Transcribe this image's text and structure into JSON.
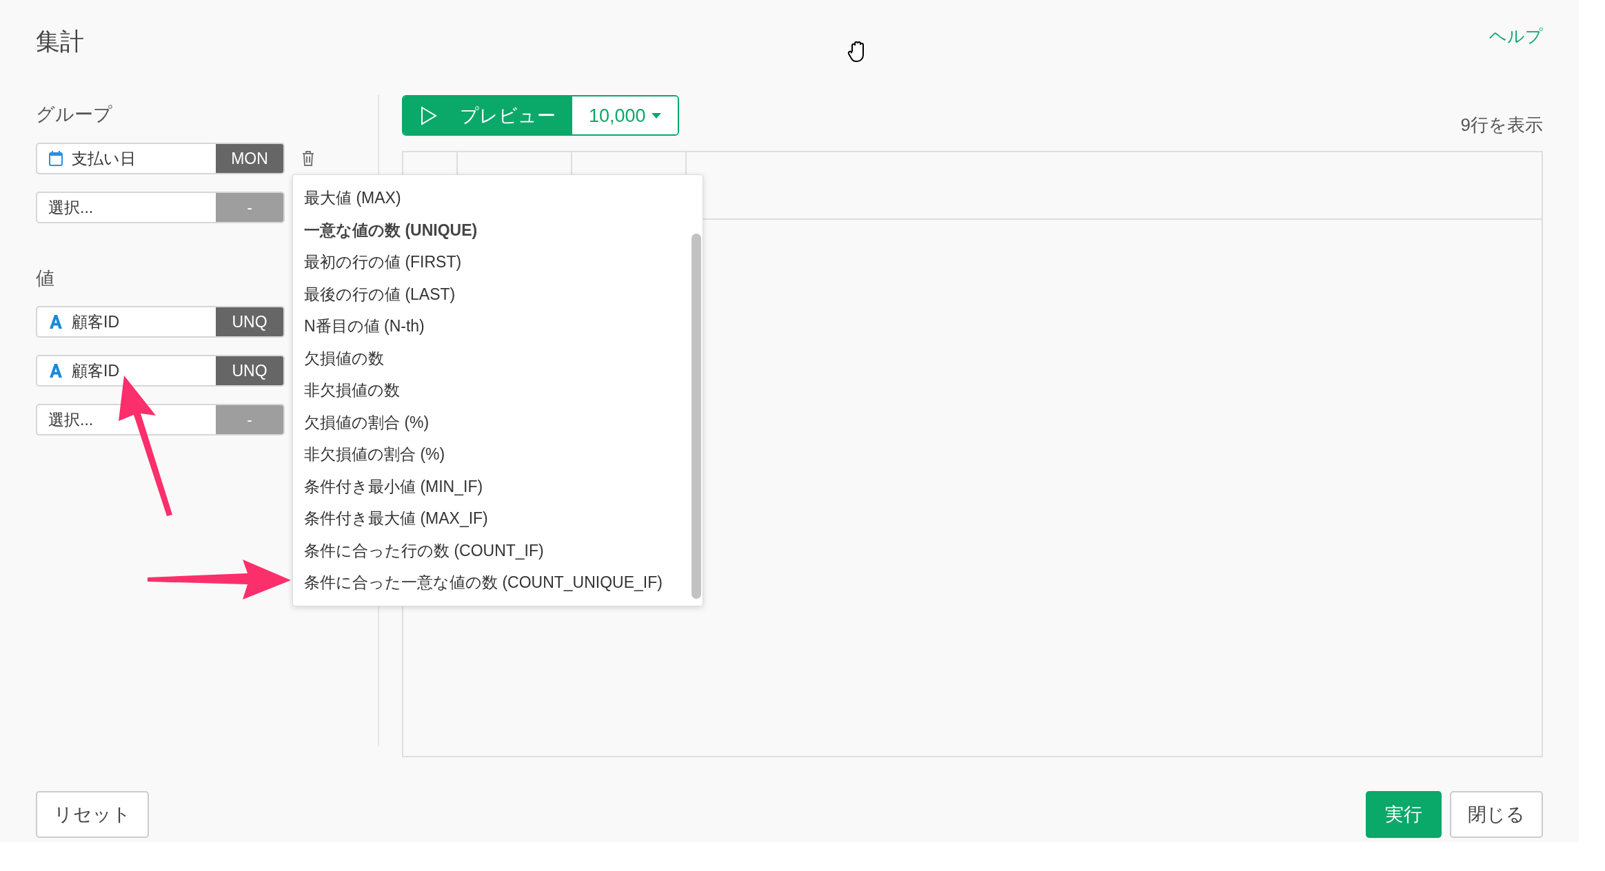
{
  "title": "集計",
  "help_link": "ヘルプ",
  "group": {
    "label": "グループ",
    "rows": [
      {
        "kind": "date",
        "text": "支払い日",
        "badge": "MON"
      },
      {
        "kind": "empty",
        "placeholder": "選択...",
        "badge": "-"
      }
    ]
  },
  "values": {
    "label": "値",
    "rows": [
      {
        "kind": "text",
        "text": "顧客ID",
        "badge": "UNQ"
      },
      {
        "kind": "text",
        "text": "顧客ID",
        "badge": "UNQ"
      },
      {
        "kind": "empty",
        "placeholder": "選択...",
        "badge": "-"
      }
    ]
  },
  "preview": {
    "label": "プレビュー",
    "count": "10,000"
  },
  "row_count": "9行を表示",
  "dropdown": {
    "items": [
      {
        "label": "最大値 (MAX)",
        "selected": false
      },
      {
        "label": "一意な値の数 (UNIQUE)",
        "selected": true
      },
      {
        "label": "最初の行の値 (FIRST)",
        "selected": false
      },
      {
        "label": "最後の行の値 (LAST)",
        "selected": false
      },
      {
        "label": "N番目の値 (N-th)",
        "selected": false
      },
      {
        "label": "欠損値の数",
        "selected": false
      },
      {
        "label": "非欠損値の数",
        "selected": false
      },
      {
        "label": "欠損値の割合 (%)",
        "selected": false
      },
      {
        "label": "非欠損値の割合 (%)",
        "selected": false
      },
      {
        "label": "条件付き最小値 (MIN_IF)",
        "selected": false
      },
      {
        "label": "条件付き最大値 (MAX_IF)",
        "selected": false
      },
      {
        "label": "条件に合った行の数 (COUNT_IF)",
        "selected": false
      },
      {
        "label": "条件に合った一意な値の数 (COUNT_UNIQUE_IF)",
        "selected": false
      }
    ]
  },
  "footer": {
    "reset": "リセット",
    "run": "実行",
    "close": "閉じる"
  }
}
